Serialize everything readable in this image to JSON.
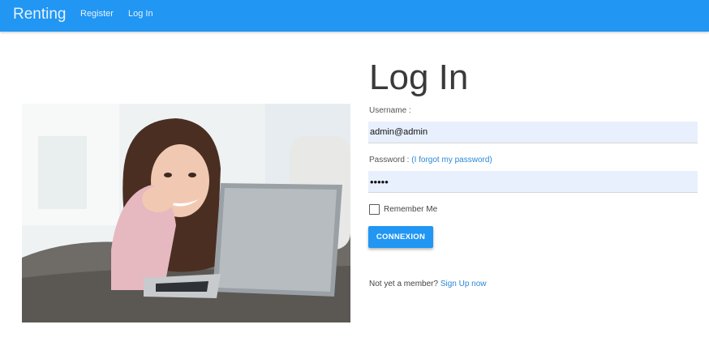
{
  "nav": {
    "brand": "Renting",
    "register": "Register",
    "login": "Log In"
  },
  "hero": {
    "alt": "Smiling woman using a laptop on a sofa"
  },
  "form": {
    "title": "Log In",
    "username_label": "Username :",
    "username_value": "admin@admin",
    "password_label": "Password :",
    "forgot_link": "(I forgot my password)",
    "password_value": "•••••",
    "remember_label": "Remember Me",
    "submit": "CONNEXION",
    "signup_prompt": "Not yet a member?",
    "signup_link": "Sign Up now"
  },
  "colors": {
    "primary": "#2196f3",
    "link": "#2a88d8",
    "input_bg": "#e8f0fe"
  }
}
